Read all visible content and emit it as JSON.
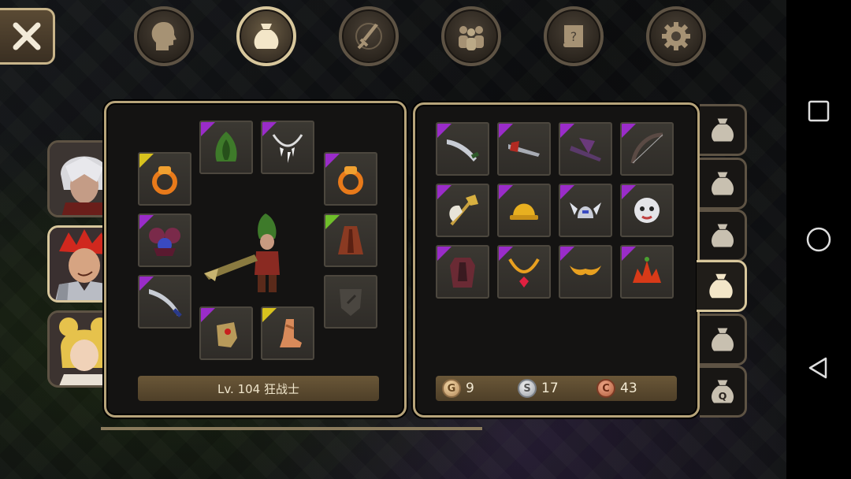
{
  "top_tabs": [
    {
      "name": "character-tab",
      "icon": "head-icon",
      "active": false
    },
    {
      "name": "inventory-tab",
      "icon": "bag-icon",
      "active": true
    },
    {
      "name": "skills-tab",
      "icon": "sword-icon",
      "active": false
    },
    {
      "name": "party-tab",
      "icon": "people-icon",
      "active": false
    },
    {
      "name": "quest-tab",
      "icon": "scroll-icon",
      "active": false
    },
    {
      "name": "settings-tab",
      "icon": "gear-icon",
      "active": false
    }
  ],
  "character": {
    "level_text": "Lv. 104 狂战士"
  },
  "currency": {
    "gold": "9",
    "silver": "17",
    "copper": "43",
    "gold_symbol": "G",
    "silver_symbol": "S",
    "copper_symbol": "C"
  },
  "bag_tabs": {
    "quest_bag_label": "Q"
  },
  "colors": {
    "rarity_epic": "#9a2cc9",
    "rarity_legendary": "#d8c21e",
    "rarity_uncommon": "#6fbf2a",
    "panel_border": "#b7a47a"
  }
}
